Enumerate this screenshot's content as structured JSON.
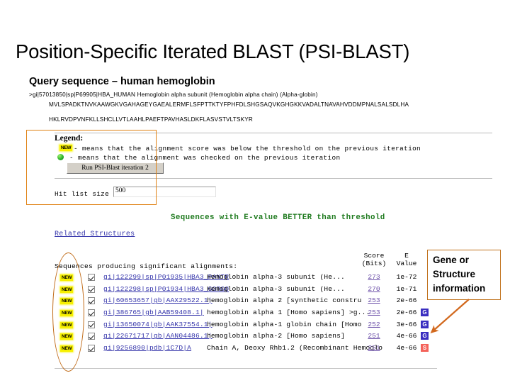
{
  "slide": {
    "title": "Position-Specific Iterated BLAST (PSI-BLAST)"
  },
  "query": {
    "heading": "Query sequence – human hemoglobin",
    "defline": ">gi|57013850|sp|P69905|HBA_HUMAN Hemoglobin alpha subunit (Hemoglobin alpha chain) (Alpha-globin)",
    "sequence_line_1": "MVLSPADKTNVKAAWGKVGAHAGEYGAEALERMFLSFPTTKTYFPHFDLSHGSAQVKGHGKKVADALTNAVAHVDDMPNALSALSDLHA",
    "sequence_line_2": "HKLRVDPVNFKLLSHCLLVTLAAHLPAEFTPAVHASLDKFLASVSTVLTSKYR"
  },
  "legend": {
    "title": "Legend:",
    "new_badge_label": "NEW",
    "row_1_text": "- means that the alignment score was below the threshold on the previous iteration",
    "row_2_text": "- means that the alignment was checked on the previous iteration",
    "run_button_label": "Run PSI-Blast iteration 2",
    "hit_list_label": "Hit list size",
    "hit_list_value": "500"
  },
  "results": {
    "better_than_threshold_header": "Sequences with E-value BETTER than threshold",
    "related_structures_link": "Related Structures",
    "desc_column_header": "Sequences producing significant alignments:",
    "score_column_header_line1": "Score",
    "score_column_header_line2": "(Bits)",
    "evalue_column_header_line1": "E",
    "evalue_column_header_line2": "Value",
    "new_badge_label": "NEW",
    "rows": [
      {
        "accession": "gi|122299|sp|P01935|HBA3_PANTR",
        "description": "Hemoglobin alpha-3 subunit (He...",
        "score": "273",
        "evalue": "1e-72",
        "badge": ""
      },
      {
        "accession": "gi|122298|sp|P01934|HBA3_GORGO",
        "description": "Hemoglobin alpha-3 subunit (He...",
        "score": "270",
        "evalue": "1e-71",
        "badge": ""
      },
      {
        "accession": "gi|60653657|gb|AAX29522.1|",
        "description": "hemoglobin alpha 2 [synthetic constru",
        "score": "253",
        "evalue": "2e-66",
        "badge": ""
      },
      {
        "accession": "gi|386765|gb|AAB59408.1|",
        "description": "hemoglobin alpha 1 [Homo sapiens] >g...",
        "score": "253",
        "evalue": "2e-66",
        "badge": "G"
      },
      {
        "accession": "gi|13650074|gb|AAK37554.1|",
        "description": "hemoglobin alpha-1 globin chain [Homo",
        "score": "252",
        "evalue": "3e-66",
        "badge": "G"
      },
      {
        "accession": "gi|22671717|gb|AAN04486.1|",
        "description": "hemoglobin alpha-2 [Homo sapiens]",
        "score": "251",
        "evalue": "4e-66",
        "badge": "G"
      },
      {
        "accession": "gi|9256890|pdb|1C7D|A",
        "description": "Chain A, Deoxy Rhb1.2 (Recombinant Hemoglo",
        "score": "251",
        "evalue": "4e-66",
        "badge": "S"
      }
    ]
  },
  "annotations": {
    "callout_line_1": "Gene or",
    "callout_line_2": "Structure",
    "callout_line_3": "information",
    "highlight_color": "#C0701A",
    "ellipse_color": "#C06A16"
  }
}
